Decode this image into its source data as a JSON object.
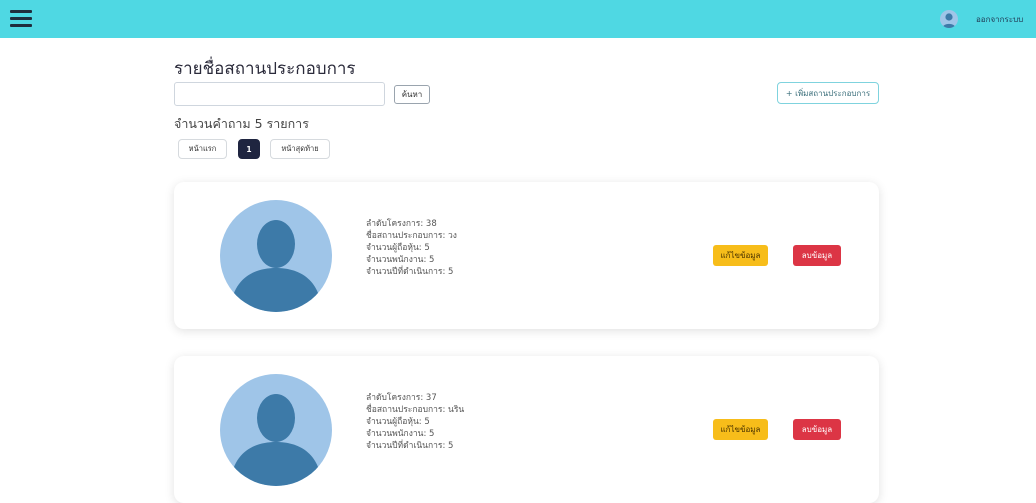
{
  "header": {
    "logout_label": "ออกจากระบบ"
  },
  "main": {
    "title": "รายชื่อสถานประกอบการ",
    "search": {
      "value": "",
      "placeholder": "",
      "button_label": "ค้นหา"
    },
    "add_button_label": "+ เพิ่มสถานประกอบการ",
    "count_label": "จำนวนคำถาม 5 รายการ",
    "pagination": {
      "first_label": "หน้าแรก",
      "current_page": "1",
      "last_label": "หน้าสุดท้าย"
    }
  },
  "cards": [
    {
      "project_no": "ลำดับโครงการ: 38",
      "business_name": "ชื่อสถานประกอบการ: วง",
      "shareholders": "จำนวนผู้ถือหุ้น: 5",
      "employees": "จำนวนพนักงาน: 5",
      "years_operating": "จำนวนปีที่ดำเนินการ: 5",
      "edit_label": "แก้ไขข้อมูล",
      "delete_label": "ลบข้อมูล"
    },
    {
      "project_no": "ลำดับโครงการ: 37",
      "business_name": "ชื่อสถานประกอบการ: นริน",
      "shareholders": "จำนวนผู้ถือหุ้น: 5",
      "employees": "จำนวนพนักงาน: 5",
      "years_operating": "จำนวนปีที่ดำเนินการ: 5",
      "edit_label": "แก้ไขข้อมูล",
      "delete_label": "ลบข้อมูล"
    }
  ],
  "colors": {
    "topbar": "#4fd8e3",
    "edit": "#f7bd1a",
    "delete": "#dc3545",
    "avatar_bg": "#9fc5e8",
    "avatar_figure": "#3d7aa8"
  },
  "icons": {
    "menu": "hamburger-menu-icon",
    "user": "user-avatar-icon"
  }
}
